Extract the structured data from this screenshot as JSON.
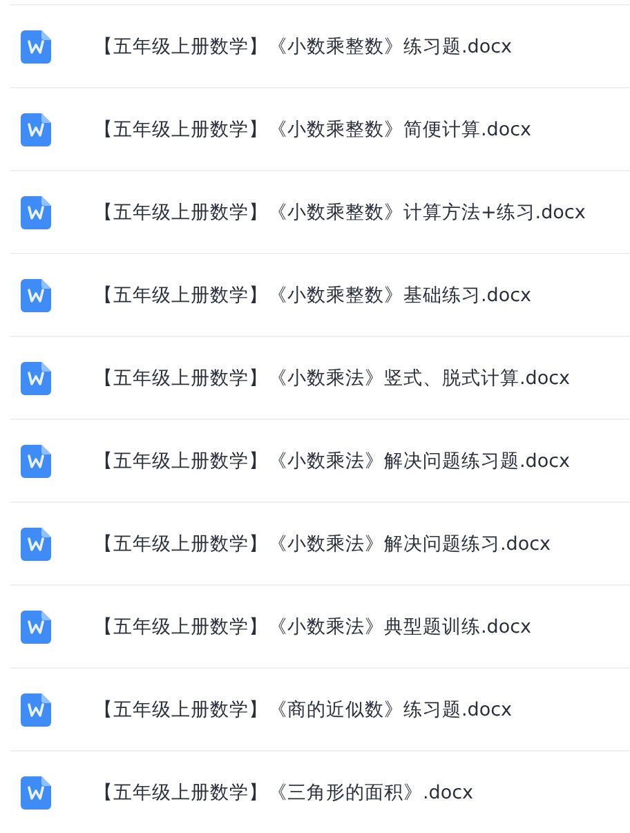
{
  "files": [
    {
      "name": "【五年级上册数学】《小数乘整数》练习题.docx"
    },
    {
      "name": "【五年级上册数学】《小数乘整数》简便计算.docx"
    },
    {
      "name": "【五年级上册数学】《小数乘整数》计算方法+练习.docx"
    },
    {
      "name": "【五年级上册数学】《小数乘整数》基础练习.docx"
    },
    {
      "name": "【五年级上册数学】《小数乘法》竖式、脱式计算.docx"
    },
    {
      "name": "【五年级上册数学】《小数乘法》解决问题练习题.docx"
    },
    {
      "name": "【五年级上册数学】《小数乘法》解决问题练习.docx"
    },
    {
      "name": "【五年级上册数学】《小数乘法》典型题训练.docx"
    },
    {
      "name": "【五年级上册数学】《商的近似数》练习题.docx"
    },
    {
      "name": "【五年级上册数学】《三角形的面积》.docx"
    }
  ]
}
